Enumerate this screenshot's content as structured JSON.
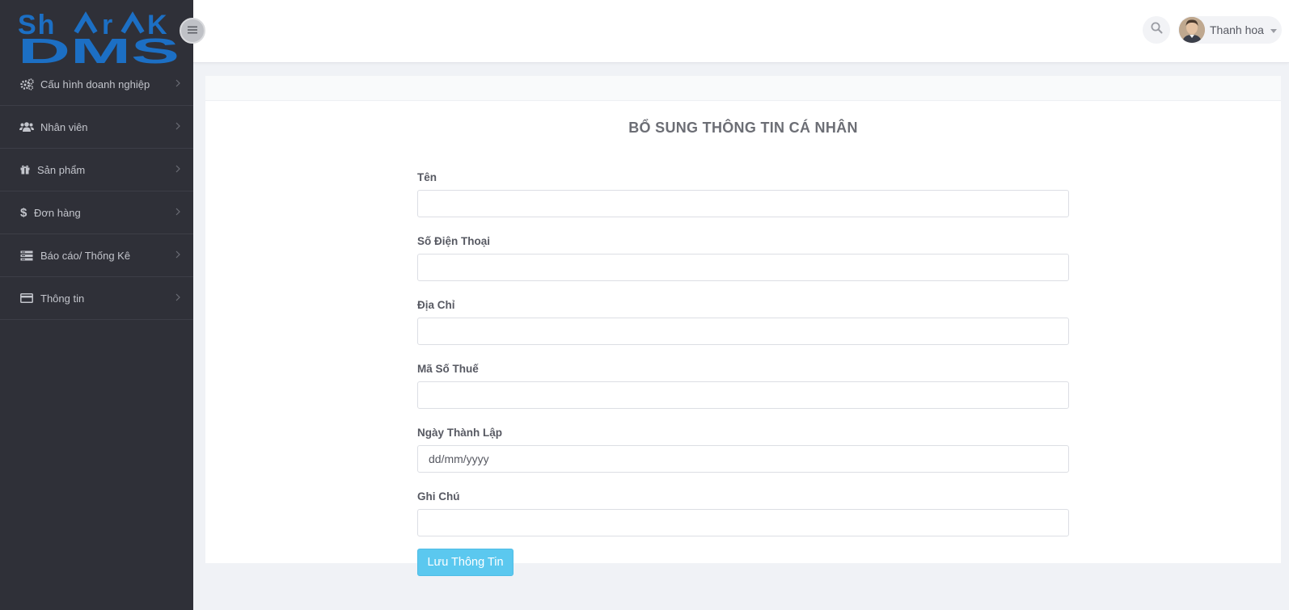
{
  "brand": {
    "logo_text_top": "ShArK",
    "logo_text_bottom": "DMS",
    "color": "#1c6fc4"
  },
  "sidebar": {
    "items": [
      {
        "label": "Cấu hình doanh nghiệp",
        "icon": "gears-icon"
      },
      {
        "label": "Nhân viên",
        "icon": "users-icon"
      },
      {
        "label": "Sản phẩm",
        "icon": "gift-icon"
      },
      {
        "label": "Đơn hàng",
        "icon": "dollar-icon"
      },
      {
        "label": "Báo cáo/ Thống Kê",
        "icon": "report-icon"
      },
      {
        "label": "Thông tin",
        "icon": "credit-card-icon"
      }
    ]
  },
  "header": {
    "user_name": "Thanh hoa"
  },
  "form": {
    "title": "BỔ SUNG THÔNG TIN CÁ NHÂN",
    "fields": [
      {
        "label": "Tên",
        "value": "",
        "placeholder": ""
      },
      {
        "label": "Số Điện Thoại",
        "value": "",
        "placeholder": ""
      },
      {
        "label": "Địa Chỉ",
        "value": "",
        "placeholder": ""
      },
      {
        "label": "Mã Số Thuế",
        "value": "",
        "placeholder": ""
      },
      {
        "label": "Ngày Thành Lập",
        "value": "",
        "placeholder": "dd/mm/yyyy"
      },
      {
        "label": "Ghi Chú",
        "value": "",
        "placeholder": ""
      }
    ],
    "submit_label": "Lưu Thông Tin"
  },
  "colors": {
    "sidebar_bg": "#2f3038",
    "accent": "#5bc8ef",
    "page_bg": "#f0f2f6"
  }
}
